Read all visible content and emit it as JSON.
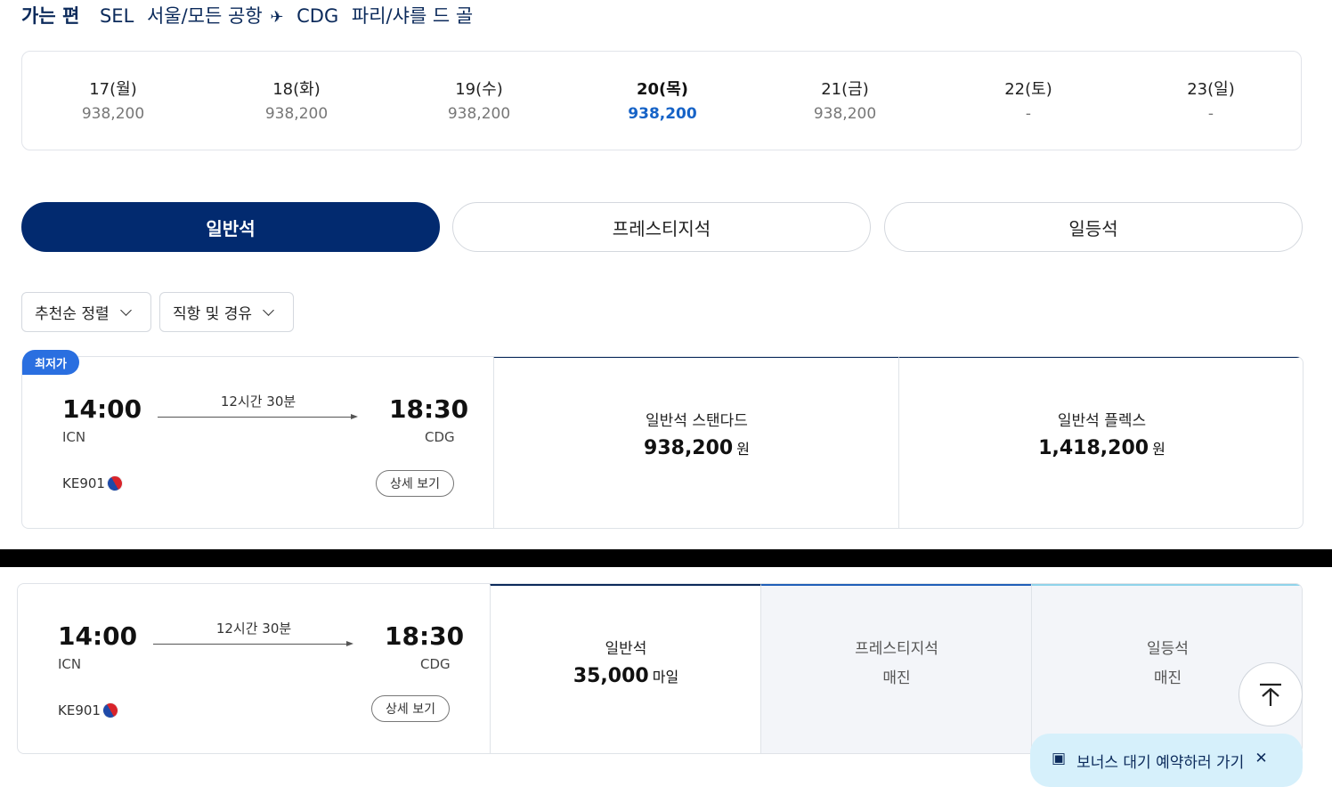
{
  "header": {
    "direction": "가는 편",
    "origin_code": "SEL",
    "origin_name": "서울/모든 공항",
    "dest_code": "CDG",
    "dest_name": "파리/샤를 드 골"
  },
  "dates": [
    {
      "day": "17(월)",
      "price": "938,200"
    },
    {
      "day": "18(화)",
      "price": "938,200"
    },
    {
      "day": "19(수)",
      "price": "938,200"
    },
    {
      "day": "20(목)",
      "price": "938,200",
      "selected": true
    },
    {
      "day": "21(금)",
      "price": "938,200"
    },
    {
      "day": "22(토)",
      "price": "-"
    },
    {
      "day": "23(일)",
      "price": "-"
    }
  ],
  "cabin_tabs": [
    "일반석",
    "프레스티지석",
    "일등석"
  ],
  "filters": {
    "sort": "추천순 정렬",
    "stops": "직항 및 경유"
  },
  "flight1": {
    "badge": "최저가",
    "dep_time": "14:00",
    "dep_airport": "ICN",
    "arr_time": "18:30",
    "arr_airport": "CDG",
    "duration": "12시간 30분",
    "flight_no": "KE901",
    "detail": "상세 보기",
    "fares": [
      {
        "name": "일반석 스탠다드",
        "amount": "938,200",
        "unit": "원"
      },
      {
        "name": "일반석 플렉스",
        "amount": "1,418,200",
        "unit": "원"
      }
    ]
  },
  "flight2": {
    "dep_time": "14:00",
    "dep_airport": "ICN",
    "arr_time": "18:30",
    "arr_airport": "CDG",
    "duration": "12시간 30분",
    "flight_no": "KE901",
    "detail": "상세 보기",
    "fares": [
      {
        "name": "일반석",
        "amount": "35,000",
        "unit": "마일"
      },
      {
        "name": "프레스티지석",
        "status": "매진"
      },
      {
        "name": "일등석",
        "status": "매진"
      }
    ]
  },
  "toast": {
    "text": "보너스 대기 예약하러 가기"
  },
  "colors": {
    "navy": "#022a6f",
    "accent_blue": "#1663c7",
    "badge_blue": "#2a6fe0",
    "toast_bg": "#d6f0fb"
  }
}
